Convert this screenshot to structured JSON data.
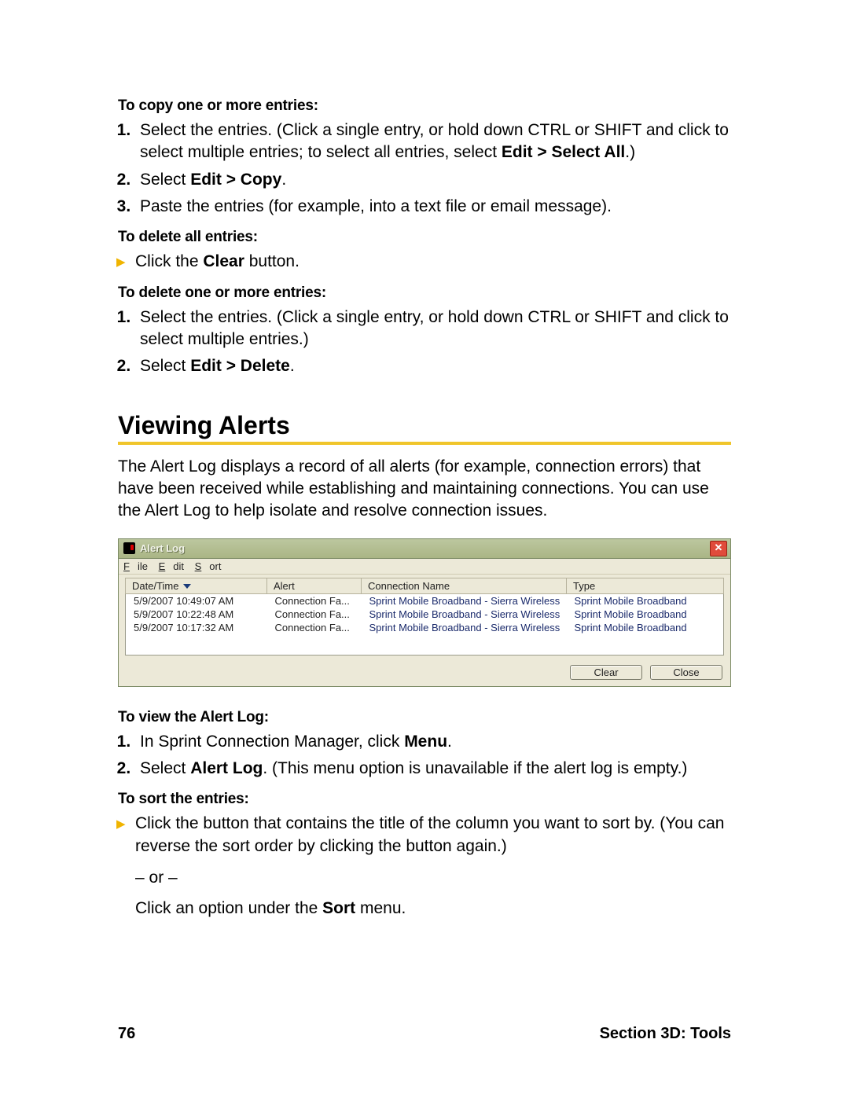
{
  "copy": {
    "heading": "To copy one or more entries:",
    "step1_a": "Select the entries. (Click a single entry, or hold down CTRL or SHIFT and click to select multiple entries; to select all entries, select ",
    "step1_bold": "Edit > Select All",
    "step1_b": ".)",
    "step2_a": "Select ",
    "step2_bold": "Edit > Copy",
    "step2_b": ".",
    "step3": "Paste the entries (for example, into a text file or email message)."
  },
  "delete_all": {
    "heading": "To delete all entries:",
    "line_a": "Click the ",
    "line_bold": "Clear",
    "line_b": " button."
  },
  "delete_some": {
    "heading": "To delete one or more entries:",
    "step1": "Select the entries. (Click a single entry, or hold down CTRL or SHIFT and click to select multiple entries.)",
    "step2_a": "Select ",
    "step2_bold": "Edit > Delete",
    "step2_b": "."
  },
  "section_title": "Viewing Alerts",
  "section_intro": "The Alert Log displays a record of all alerts (for example, connection errors) that have been received while establishing and maintaining connections. You can use the Alert Log to help isolate and resolve connection issues.",
  "alert_window": {
    "title": "Alert Log",
    "menus": {
      "file": "File",
      "edit": "Edit",
      "sort": "Sort"
    },
    "columns": {
      "date": "Date/Time",
      "alert": "Alert",
      "conn": "Connection Name",
      "type": "Type"
    },
    "rows": [
      {
        "date": "5/9/2007 10:49:07 AM",
        "alert": "Connection Fa...",
        "conn": "Sprint Mobile Broadband - Sierra Wireless",
        "type": "Sprint Mobile Broadband"
      },
      {
        "date": "5/9/2007 10:22:48 AM",
        "alert": "Connection Fa...",
        "conn": "Sprint Mobile Broadband - Sierra Wireless",
        "type": "Sprint Mobile Broadband"
      },
      {
        "date": "5/9/2007 10:17:32 AM",
        "alert": "Connection Fa...",
        "conn": "Sprint Mobile Broadband - Sierra Wireless",
        "type": "Sprint Mobile Broadband"
      }
    ],
    "buttons": {
      "clear": "Clear",
      "close": "Close"
    }
  },
  "view_log": {
    "heading": "To view the Alert Log:",
    "step1_a": "In Sprint Connection Manager, click ",
    "step1_bold": "Menu",
    "step1_b": ".",
    "step2_a": "Select ",
    "step2_bold": "Alert Log",
    "step2_b": ". (This menu option is unavailable if the alert log is empty.)"
  },
  "sort": {
    "heading": "To sort the entries:",
    "line1": "Click the button that contains the title of the column you want to sort by. (You can reverse the sort order by clicking the button again.)",
    "or": "– or –",
    "line2_a": "Click an option under the ",
    "line2_bold": "Sort",
    "line2_b": " menu."
  },
  "footer": {
    "page": "76",
    "section": "Section 3D: Tools"
  }
}
